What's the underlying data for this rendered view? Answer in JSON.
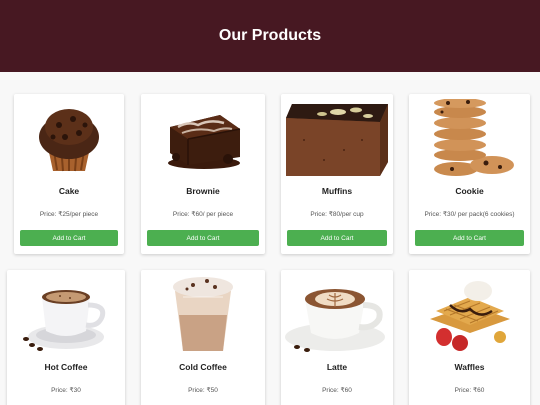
{
  "header": {
    "title": "Our Products"
  },
  "products": [
    {
      "name": "Cake",
      "price": "Price: ₹25/per piece",
      "button": "Add to Cart",
      "image_icon": "muffin-cake-image"
    },
    {
      "name": "Brownie",
      "price": "Price: ₹60/ per piece",
      "button": "Add to Cart",
      "image_icon": "brownie-image"
    },
    {
      "name": "Muffins",
      "price": "Price: ₹80/per cup",
      "button": "Add to Cart",
      "image_icon": "chocolate-loaf-image"
    },
    {
      "name": "Cookie",
      "price": "Price: ₹30/ per pack(6 cookies)",
      "button": "Add to Cart",
      "image_icon": "cookie-stack-image"
    },
    {
      "name": "Hot Coffee",
      "price": "Price: ₹30",
      "image_icon": "hot-coffee-cup-image"
    },
    {
      "name": "Cold Coffee",
      "price": "Price: ₹50",
      "image_icon": "cold-coffee-cup-image"
    },
    {
      "name": "Latte",
      "price": "Price: ₹60",
      "image_icon": "latte-art-cup-image"
    },
    {
      "name": "Waffles",
      "price": "Price: ₹60",
      "image_icon": "waffles-image"
    }
  ],
  "colors": {
    "header_bg": "#471822",
    "button_bg": "#4caf50"
  }
}
